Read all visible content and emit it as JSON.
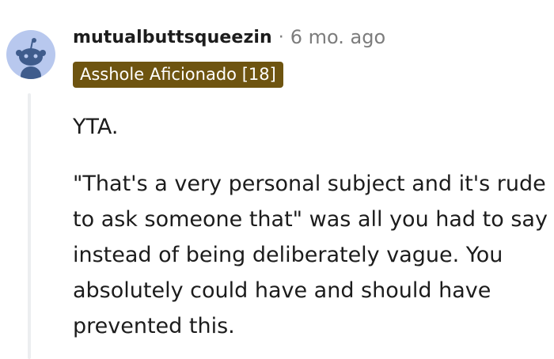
{
  "comment": {
    "author": "mutualbuttsqueezin",
    "separator": "·",
    "timestamp": "6 mo. ago",
    "flair": "Asshole Aficionado [18]",
    "avatar_icon": "reddit-snoo-avatar",
    "paragraphs": [
      "YTA.",
      "\"That's a very personal subject and it's rude to ask someone that\" was all you had to say instead of being deliberately vague. You absolutely could have and should have prevented this."
    ]
  },
  "colors": {
    "flair_background": "#6e5410",
    "flair_text": "#ffffff",
    "avatar_background": "#b8c8ee",
    "thread_line": "#eceef0",
    "meta_gray": "#7c7c7c"
  }
}
